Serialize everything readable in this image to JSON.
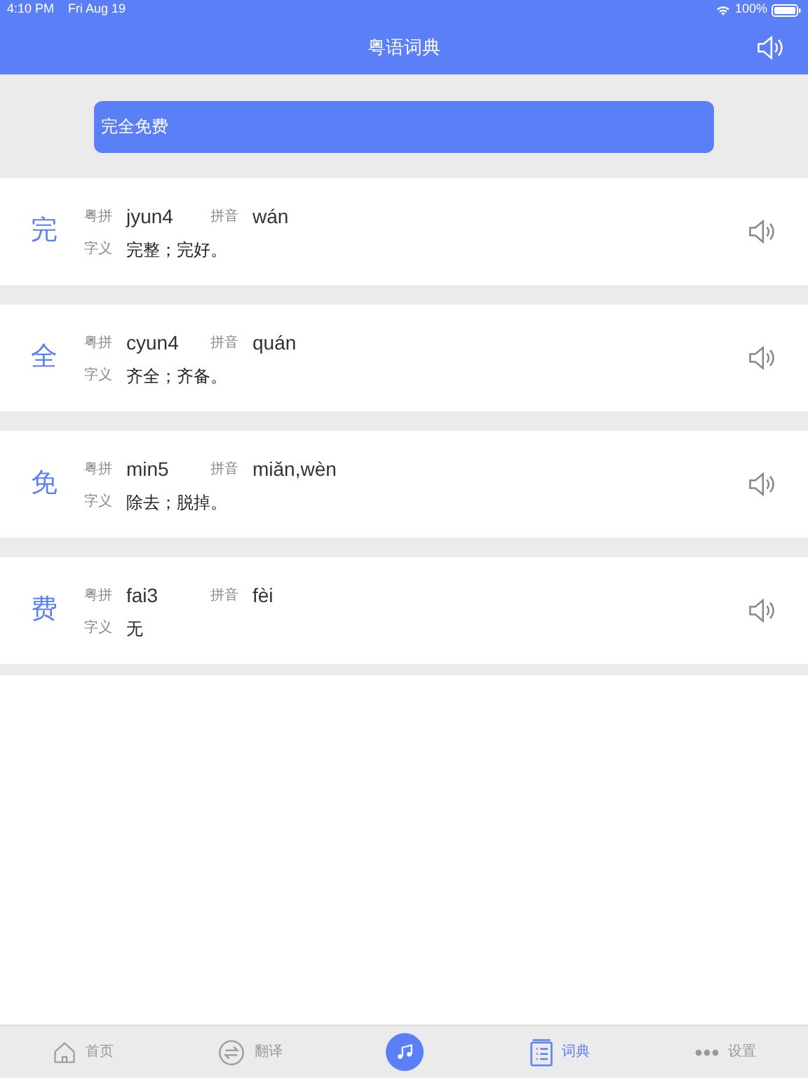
{
  "status_bar": {
    "time": "4:10 PM",
    "date": "Fri Aug 19",
    "battery": "100%"
  },
  "header": {
    "title": "粤语词典"
  },
  "search": {
    "value": "完全免费"
  },
  "entries": [
    {
      "char": "完",
      "jyutping_label": "粤拼",
      "jyutping": "jyun4",
      "pinyin_label": "拼音",
      "pinyin": "wán",
      "meaning_label": "字义",
      "meaning": "完整；完好。"
    },
    {
      "char": "全",
      "jyutping_label": "粤拼",
      "jyutping": "cyun4",
      "pinyin_label": "拼音",
      "pinyin": "quán",
      "meaning_label": "字义",
      "meaning": "齐全；齐备。"
    },
    {
      "char": "免",
      "jyutping_label": "粤拼",
      "jyutping": "min5",
      "pinyin_label": "拼音",
      "pinyin": "miǎn,wèn",
      "meaning_label": "字义",
      "meaning": "除去；脱掉。"
    },
    {
      "char": "费",
      "jyutping_label": "粤拼",
      "jyutping": "fai3",
      "pinyin_label": "拼音",
      "pinyin": "fèi",
      "meaning_label": "字义",
      "meaning": "无"
    }
  ],
  "tab_bar": [
    {
      "kind": "home",
      "label": "首页",
      "selected": false
    },
    {
      "kind": "translate",
      "label": "翻译",
      "selected": false
    },
    {
      "kind": "music",
      "selected": false
    },
    {
      "kind": "dictionary",
      "label": "词典",
      "selected": true
    },
    {
      "kind": "settings",
      "label": "设置",
      "selected": false
    }
  ]
}
